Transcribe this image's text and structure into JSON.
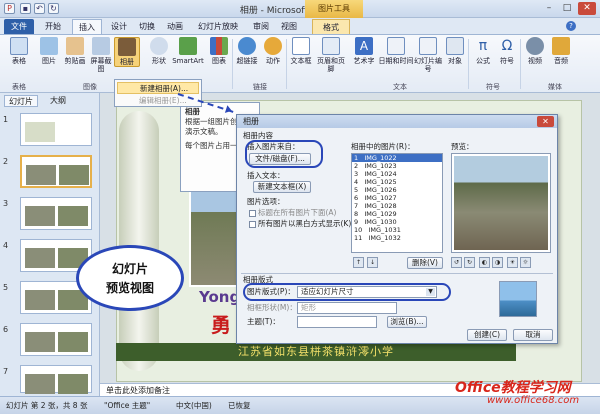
{
  "window": {
    "title": "相册 - Microsoft PowerPoint",
    "context_tab": "图片工具"
  },
  "tabs": [
    "文件",
    "开始",
    "插入",
    "设计",
    "切换",
    "动画",
    "幻灯片放映",
    "审阅",
    "视图",
    "格式"
  ],
  "ribbon": {
    "buttons": [
      "表格",
      "图片",
      "剪贴画",
      "屏幕截图",
      "相册",
      "形状",
      "SmartArt",
      "图表",
      "超链接",
      "动作",
      "文本框",
      "页眉和页脚",
      "艺术字",
      "日期和时间",
      "幻灯片编号",
      "对象",
      "公式",
      "符号",
      "视频",
      "音频"
    ],
    "groups": [
      "表格",
      "图像",
      "链接",
      "文本",
      "符号",
      "媒体"
    ]
  },
  "album_menu": {
    "new": "新建相册(A)...",
    "edit": "编辑相册(E)..."
  },
  "left_pane": {
    "tabs": [
      "幻灯片",
      "大纲"
    ],
    "slides": [
      "1",
      "2",
      "3",
      "4",
      "5",
      "6",
      "7"
    ]
  },
  "hint": {
    "lines": [
      "相册",
      "根据一组图片创建或",
      "演示文稿。",
      "每个图片占用一"
    ]
  },
  "callout": {
    "line1": "幻灯片",
    "line2": "预览视图"
  },
  "slide": {
    "yong": "Yong",
    "yong2": "勇",
    "banner": "江苏省如东县栟茶镇浒澪小学"
  },
  "notes": "单击此处添加备注",
  "dialog": {
    "title": "相册",
    "album_content": "相册内容",
    "insert_from": "插入图片来自：",
    "file_disk": "文件/磁盘(F)...",
    "insert_text": "插入文本：",
    "new_textbox": "新建文本框(X)",
    "picture_options": "图片选项：",
    "caption_below": "标题在所有图片下面(A)",
    "all_bw": "所有图片以黑白方式显示(K)",
    "pictures_in_album": "相册中的图片(R)：",
    "preview": "预览：",
    "list": [
      {
        "n": "1",
        "name": "IMG_1022"
      },
      {
        "n": "2",
        "name": "IMG_1023"
      },
      {
        "n": "3",
        "name": "IMG_1024"
      },
      {
        "n": "4",
        "name": "IMG_1025"
      },
      {
        "n": "5",
        "name": "IMG_1026"
      },
      {
        "n": "6",
        "name": "IMG_1027"
      },
      {
        "n": "7",
        "name": "IMG_1028"
      },
      {
        "n": "8",
        "name": "IMG_1029"
      },
      {
        "n": "9",
        "name": "IMG_1030"
      },
      {
        "n": "10",
        "name": "IMG_1031"
      },
      {
        "n": "11",
        "name": "IMG_1032"
      }
    ],
    "delete": "删除(V)",
    "album_layout": "相册版式",
    "picture_layout_label": "图片版式(P)：",
    "picture_layout_value": "适应幻灯片尺寸",
    "frame_shape_label": "相框形状(M)：",
    "frame_shape_value": "矩形",
    "theme_label": "主题(T)：",
    "browse": "浏览(B)...",
    "create": "创建(C)",
    "cancel": "取消"
  },
  "status": {
    "slide": "幻灯片 第 2 张，共 8 张",
    "theme": "\"Office 主题\"",
    "lang": "中文(中国)",
    "saved": "已恢复"
  },
  "watermark": {
    "line1": "Office教程学习网",
    "line2": "www.office68.com"
  },
  "colors": {
    "accent": "#2a47b8",
    "file_tab": "#2e5fa8",
    "banner_text": "#f5e26a",
    "watermark": "#d8261b"
  }
}
